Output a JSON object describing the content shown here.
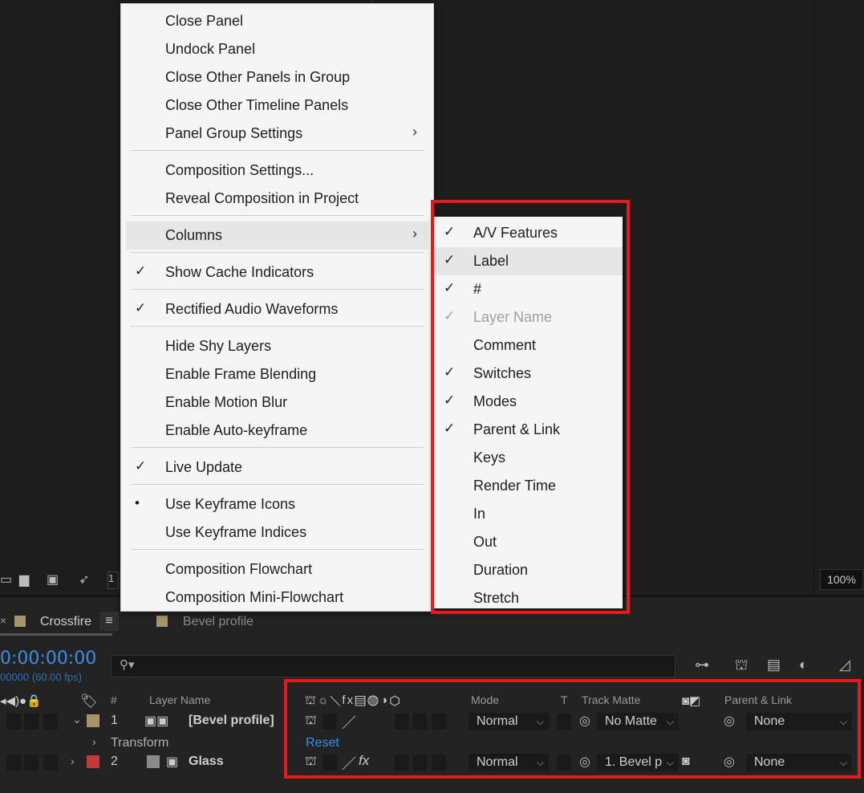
{
  "viewer": {
    "zoom": "100%"
  },
  "tabs": [
    {
      "label": "Crossfire",
      "color": "#a8946a"
    },
    {
      "label": "Bevel profile",
      "color": "#a8946a"
    }
  ],
  "timeline": {
    "time": "0:00:00:00",
    "fps": "00000 (60.00 fps)",
    "headers": {
      "hash": "#",
      "layer_name": "Layer Name",
      "mode": "Mode",
      "t": "T",
      "track_matte": "Track Matte",
      "parent_link": "Parent & Link"
    },
    "layers": [
      {
        "num": "1",
        "name": "[Bevel profile]",
        "label_color": "#a8946a",
        "mode": "Normal",
        "matte": "No Matte",
        "parent": "None"
      },
      {
        "num": "2",
        "name": "Glass",
        "label_color": "#c23a3a",
        "mode": "Normal",
        "matte": "1. Bevel p",
        "parent": "None"
      }
    ],
    "transform": {
      "label": "Transform",
      "reset": "Reset"
    }
  },
  "menu": {
    "items": [
      {
        "label": "Close Panel",
        "check": "",
        "submenu": false
      },
      {
        "label": "Undock Panel",
        "check": "",
        "submenu": false
      },
      {
        "label": "Close Other Panels in Group",
        "check": "",
        "submenu": false
      },
      {
        "label": "Close Other Timeline Panels",
        "check": "",
        "submenu": false
      },
      {
        "label": "Panel Group Settings",
        "check": "",
        "submenu": true
      },
      {
        "label": "Composition Settings...",
        "check": "",
        "submenu": false
      },
      {
        "label": "Reveal Composition in Project",
        "check": "",
        "submenu": false
      },
      {
        "label": "Columns",
        "check": "",
        "submenu": true
      },
      {
        "label": "Show Cache Indicators",
        "check": "✓",
        "submenu": false
      },
      {
        "label": "Rectified Audio Waveforms",
        "check": "✓",
        "submenu": false
      },
      {
        "label": "Hide Shy Layers",
        "check": "",
        "submenu": false
      },
      {
        "label": "Enable Frame Blending",
        "check": "",
        "submenu": false
      },
      {
        "label": "Enable Motion Blur",
        "check": "",
        "submenu": false
      },
      {
        "label": "Enable Auto-keyframe",
        "check": "",
        "submenu": false
      },
      {
        "label": "Live Update",
        "check": "✓",
        "submenu": false
      },
      {
        "label": "Use Keyframe Icons",
        "check": "•",
        "submenu": false
      },
      {
        "label": "Use Keyframe Indices",
        "check": "",
        "submenu": false
      },
      {
        "label": "Composition Flowchart",
        "check": "",
        "submenu": false
      },
      {
        "label": "Composition Mini-Flowchart",
        "check": "",
        "submenu": false
      }
    ],
    "submenu_arrow": "›"
  },
  "columns_submenu": {
    "items": [
      {
        "label": "A/V Features",
        "check": "✓",
        "disabled": false
      },
      {
        "label": "Label",
        "check": "✓",
        "disabled": false
      },
      {
        "label": "#",
        "check": "✓",
        "disabled": false
      },
      {
        "label": "Layer Name",
        "check": "✓",
        "disabled": true
      },
      {
        "label": "Comment",
        "check": "",
        "disabled": false
      },
      {
        "label": "Switches",
        "check": "✓",
        "disabled": false
      },
      {
        "label": "Modes",
        "check": "✓",
        "disabled": false
      },
      {
        "label": "Parent & Link",
        "check": "✓",
        "disabled": false
      },
      {
        "label": "Keys",
        "check": "",
        "disabled": false
      },
      {
        "label": "Render Time",
        "check": "",
        "disabled": false
      },
      {
        "label": "In",
        "check": "",
        "disabled": false
      },
      {
        "label": "Out",
        "check": "",
        "disabled": false
      },
      {
        "label": "Duration",
        "check": "",
        "disabled": false
      },
      {
        "label": "Stretch",
        "check": "",
        "disabled": false
      }
    ]
  },
  "highlight_color": "#e8191b"
}
